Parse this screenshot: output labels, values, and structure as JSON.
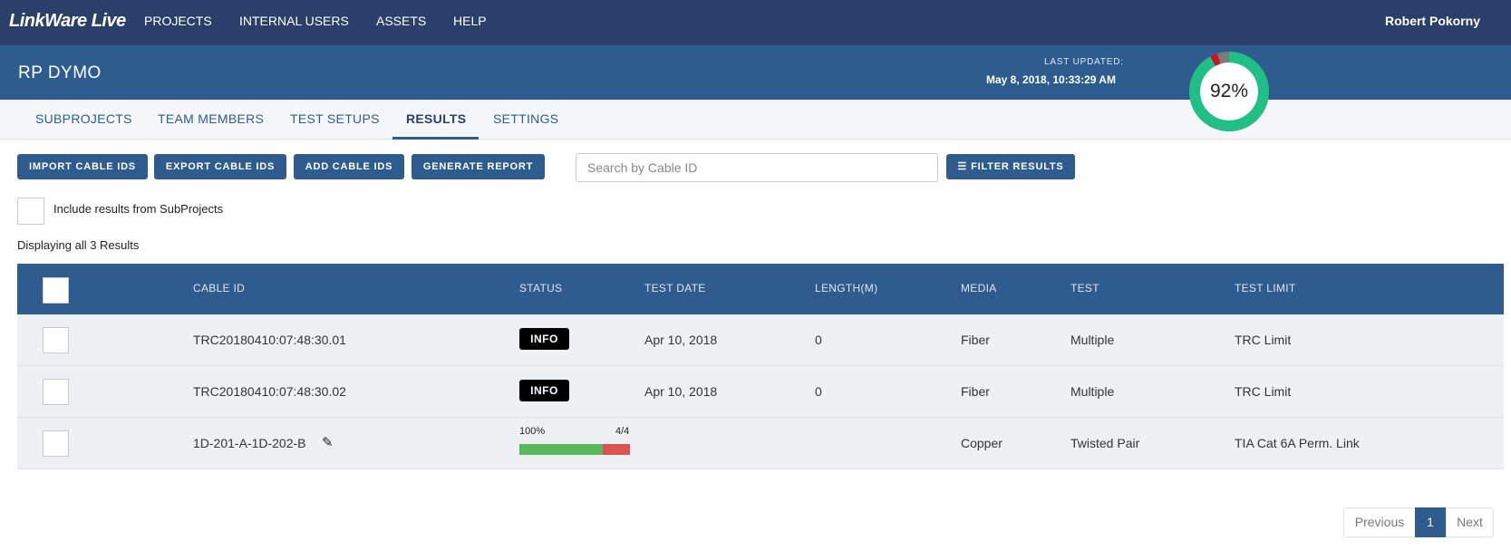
{
  "brand": {
    "logo": "LinkWare Live"
  },
  "nav": {
    "items": [
      "PROJECTS",
      "INTERNAL USERS",
      "ASSETS",
      "HELP"
    ],
    "user": "Robert Pokorny"
  },
  "project": {
    "title": "RP DYMO",
    "last_updated_label": "LAST UPDATED:",
    "last_updated_value": "May 8, 2018, 10:33:29 AM",
    "progress_label": "92%",
    "progress_pass_fraction": 0.92,
    "progress_fail_fraction": 0.03
  },
  "tabs": [
    "SUBPROJECTS",
    "TEAM MEMBERS",
    "TEST SETUPS",
    "RESULTS",
    "SETTINGS"
  ],
  "active_tab": "RESULTS",
  "toolbar": {
    "import": "IMPORT CABLE IDS",
    "export": "EXPORT CABLE IDS",
    "add": "ADD CABLE IDS",
    "report": "GENERATE REPORT",
    "search_placeholder": "Search by Cable ID",
    "filter": "FILTER RESULTS"
  },
  "include_subprojects_label": "Include results from SubProjects",
  "display_count": "Displaying all 3 Results",
  "table": {
    "columns": [
      "CABLE ID",
      "STATUS",
      "TEST DATE",
      "LENGTH(M)",
      "MEDIA",
      "TEST",
      "TEST LIMIT"
    ],
    "rows": [
      {
        "cable_id": "TRC20180410:07:48:30.01",
        "status": "INFO",
        "test_date": "Apr 10, 2018",
        "length": "0",
        "media": "Fiber",
        "test": "Multiple",
        "limit": "TRC Limit"
      },
      {
        "cable_id": "TRC20180410:07:48:30.02",
        "status": "INFO",
        "test_date": "Apr 10, 2018",
        "length": "0",
        "media": "Fiber",
        "test": "Multiple",
        "limit": "TRC Limit"
      },
      {
        "cable_id": "1D-201-A-1D-202-B",
        "progress_pct": "100%",
        "progress_frac": "4/4",
        "progress_green_fraction": 0.75,
        "media": "Copper",
        "test": "Twisted Pair",
        "limit": "TIA Cat 6A Perm. Link"
      }
    ]
  },
  "pagination": {
    "prev": "Previous",
    "page": "1",
    "next": "Next"
  },
  "colors": {
    "nav": "#2b3f6b",
    "header": "#2e5c8f",
    "pass": "#1fbf85",
    "fail": "#c9161d",
    "pending": "#7a7a7a"
  }
}
